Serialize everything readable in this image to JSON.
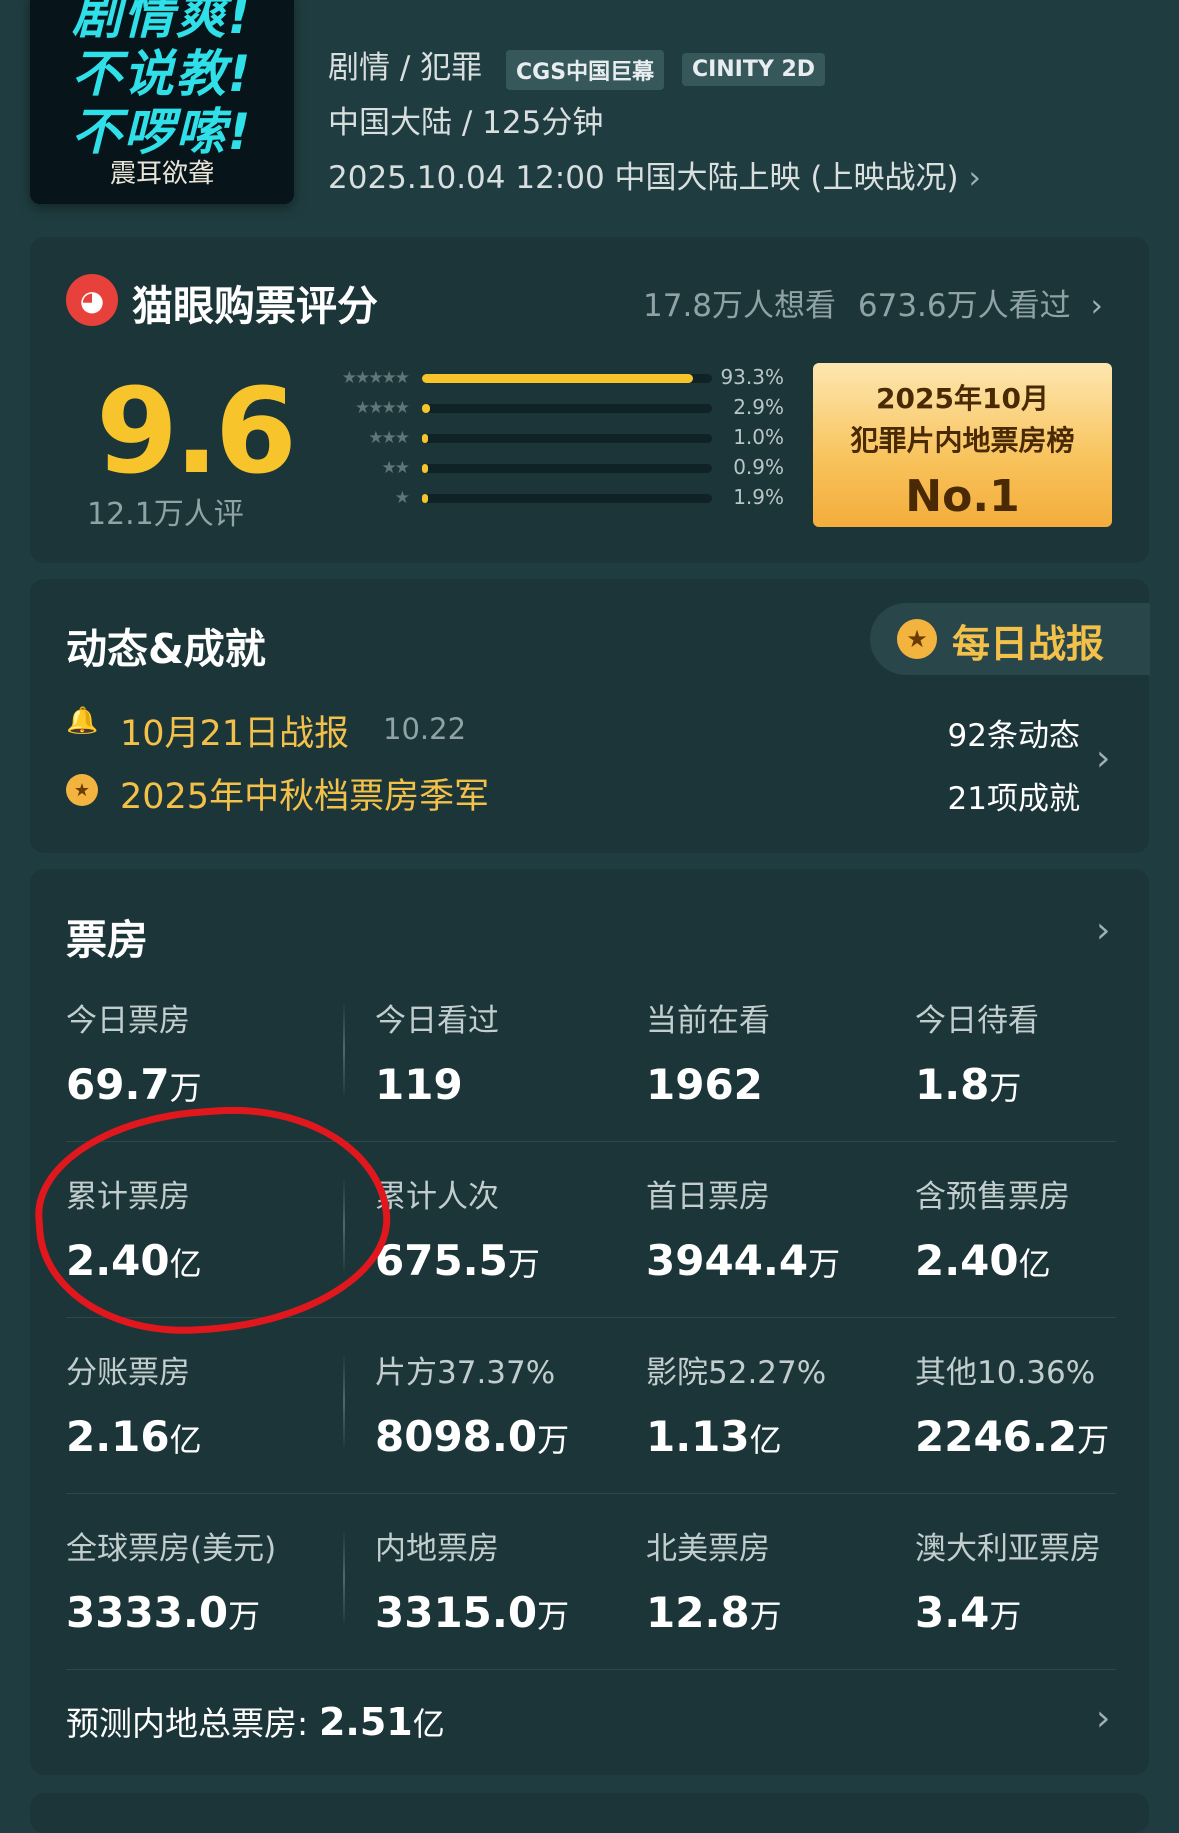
{
  "movie": {
    "poster_lines": [
      "剧情爽!",
      "不说教!",
      "不啰嗦!"
    ],
    "poster_studio": "震耳欲聋",
    "genre": "剧情 / 犯罪",
    "formats": [
      "CGS中国巨幕",
      "CINITY 2D"
    ],
    "region_duration": "中国大陆 / 125分钟",
    "release": "2025.10.04 12:00 中国大陆上映 (上映战况)"
  },
  "rating": {
    "title": "猫眼购票评分",
    "want_watch": "17.8万人想看",
    "watched": "673.6万人看过",
    "score": "9.6",
    "raters": "12.1万人评",
    "distribution": [
      {
        "stars": "★★★★★",
        "percent_label": "93.3%",
        "value": 93.3
      },
      {
        "stars": "★★★★",
        "percent_label": "2.9%",
        "value": 2.9
      },
      {
        "stars": "★★★",
        "percent_label": "1.0%",
        "value": 1.0
      },
      {
        "stars": "★★",
        "percent_label": "0.9%",
        "value": 0.9
      },
      {
        "stars": "★",
        "percent_label": "1.9%",
        "value": 1.9
      }
    ],
    "rank": {
      "line1": "2025年10月",
      "line2": "犯罪片内地票房榜",
      "line3": "No.1"
    }
  },
  "dynamics": {
    "title": "动态&成就",
    "daily_report": "每日战报",
    "report_title": "10月21日战报",
    "report_date": "10.22",
    "achievement": "2025年中秋档票房季军",
    "dynamic_count": "92条动态",
    "achievement_count": "21项成就"
  },
  "boxoffice": {
    "title": "票房",
    "rows": [
      [
        {
          "label": "今日票房",
          "value": "69.7",
          "unit": "万"
        },
        {
          "label": "今日看过",
          "value": "119",
          "unit": ""
        },
        {
          "label": "当前在看",
          "value": "1962",
          "unit": ""
        },
        {
          "label": "今日待看",
          "value": "1.8",
          "unit": "万"
        }
      ],
      [
        {
          "label": "累计票房",
          "value": "2.40",
          "unit": "亿"
        },
        {
          "label": "累计人次",
          "value": "675.5",
          "unit": "万"
        },
        {
          "label": "首日票房",
          "value": "3944.4",
          "unit": "万"
        },
        {
          "label": "含预售票房",
          "value": "2.40",
          "unit": "亿"
        }
      ],
      [
        {
          "label": "分账票房",
          "value": "2.16",
          "unit": "亿"
        },
        {
          "label": "片方37.37%",
          "value": "8098.0",
          "unit": "万"
        },
        {
          "label": "影院52.27%",
          "value": "1.13",
          "unit": "亿"
        },
        {
          "label": "其他10.36%",
          "value": "2246.2",
          "unit": "万"
        }
      ],
      [
        {
          "label": "全球票房(美元)",
          "value": "3333.0",
          "unit": "万"
        },
        {
          "label": "内地票房",
          "value": "3315.0",
          "unit": "万"
        },
        {
          "label": "北美票房",
          "value": "12.8",
          "unit": "万"
        },
        {
          "label": "澳大利亚票房",
          "value": "3.4",
          "unit": "万"
        }
      ]
    ],
    "forecast_label": "预测内地总票房:",
    "forecast_value": "2.51",
    "forecast_unit": "亿"
  },
  "colors": {
    "accent": "#f7c52b",
    "background": "#1f3d40",
    "highlight": "#e0181e"
  }
}
